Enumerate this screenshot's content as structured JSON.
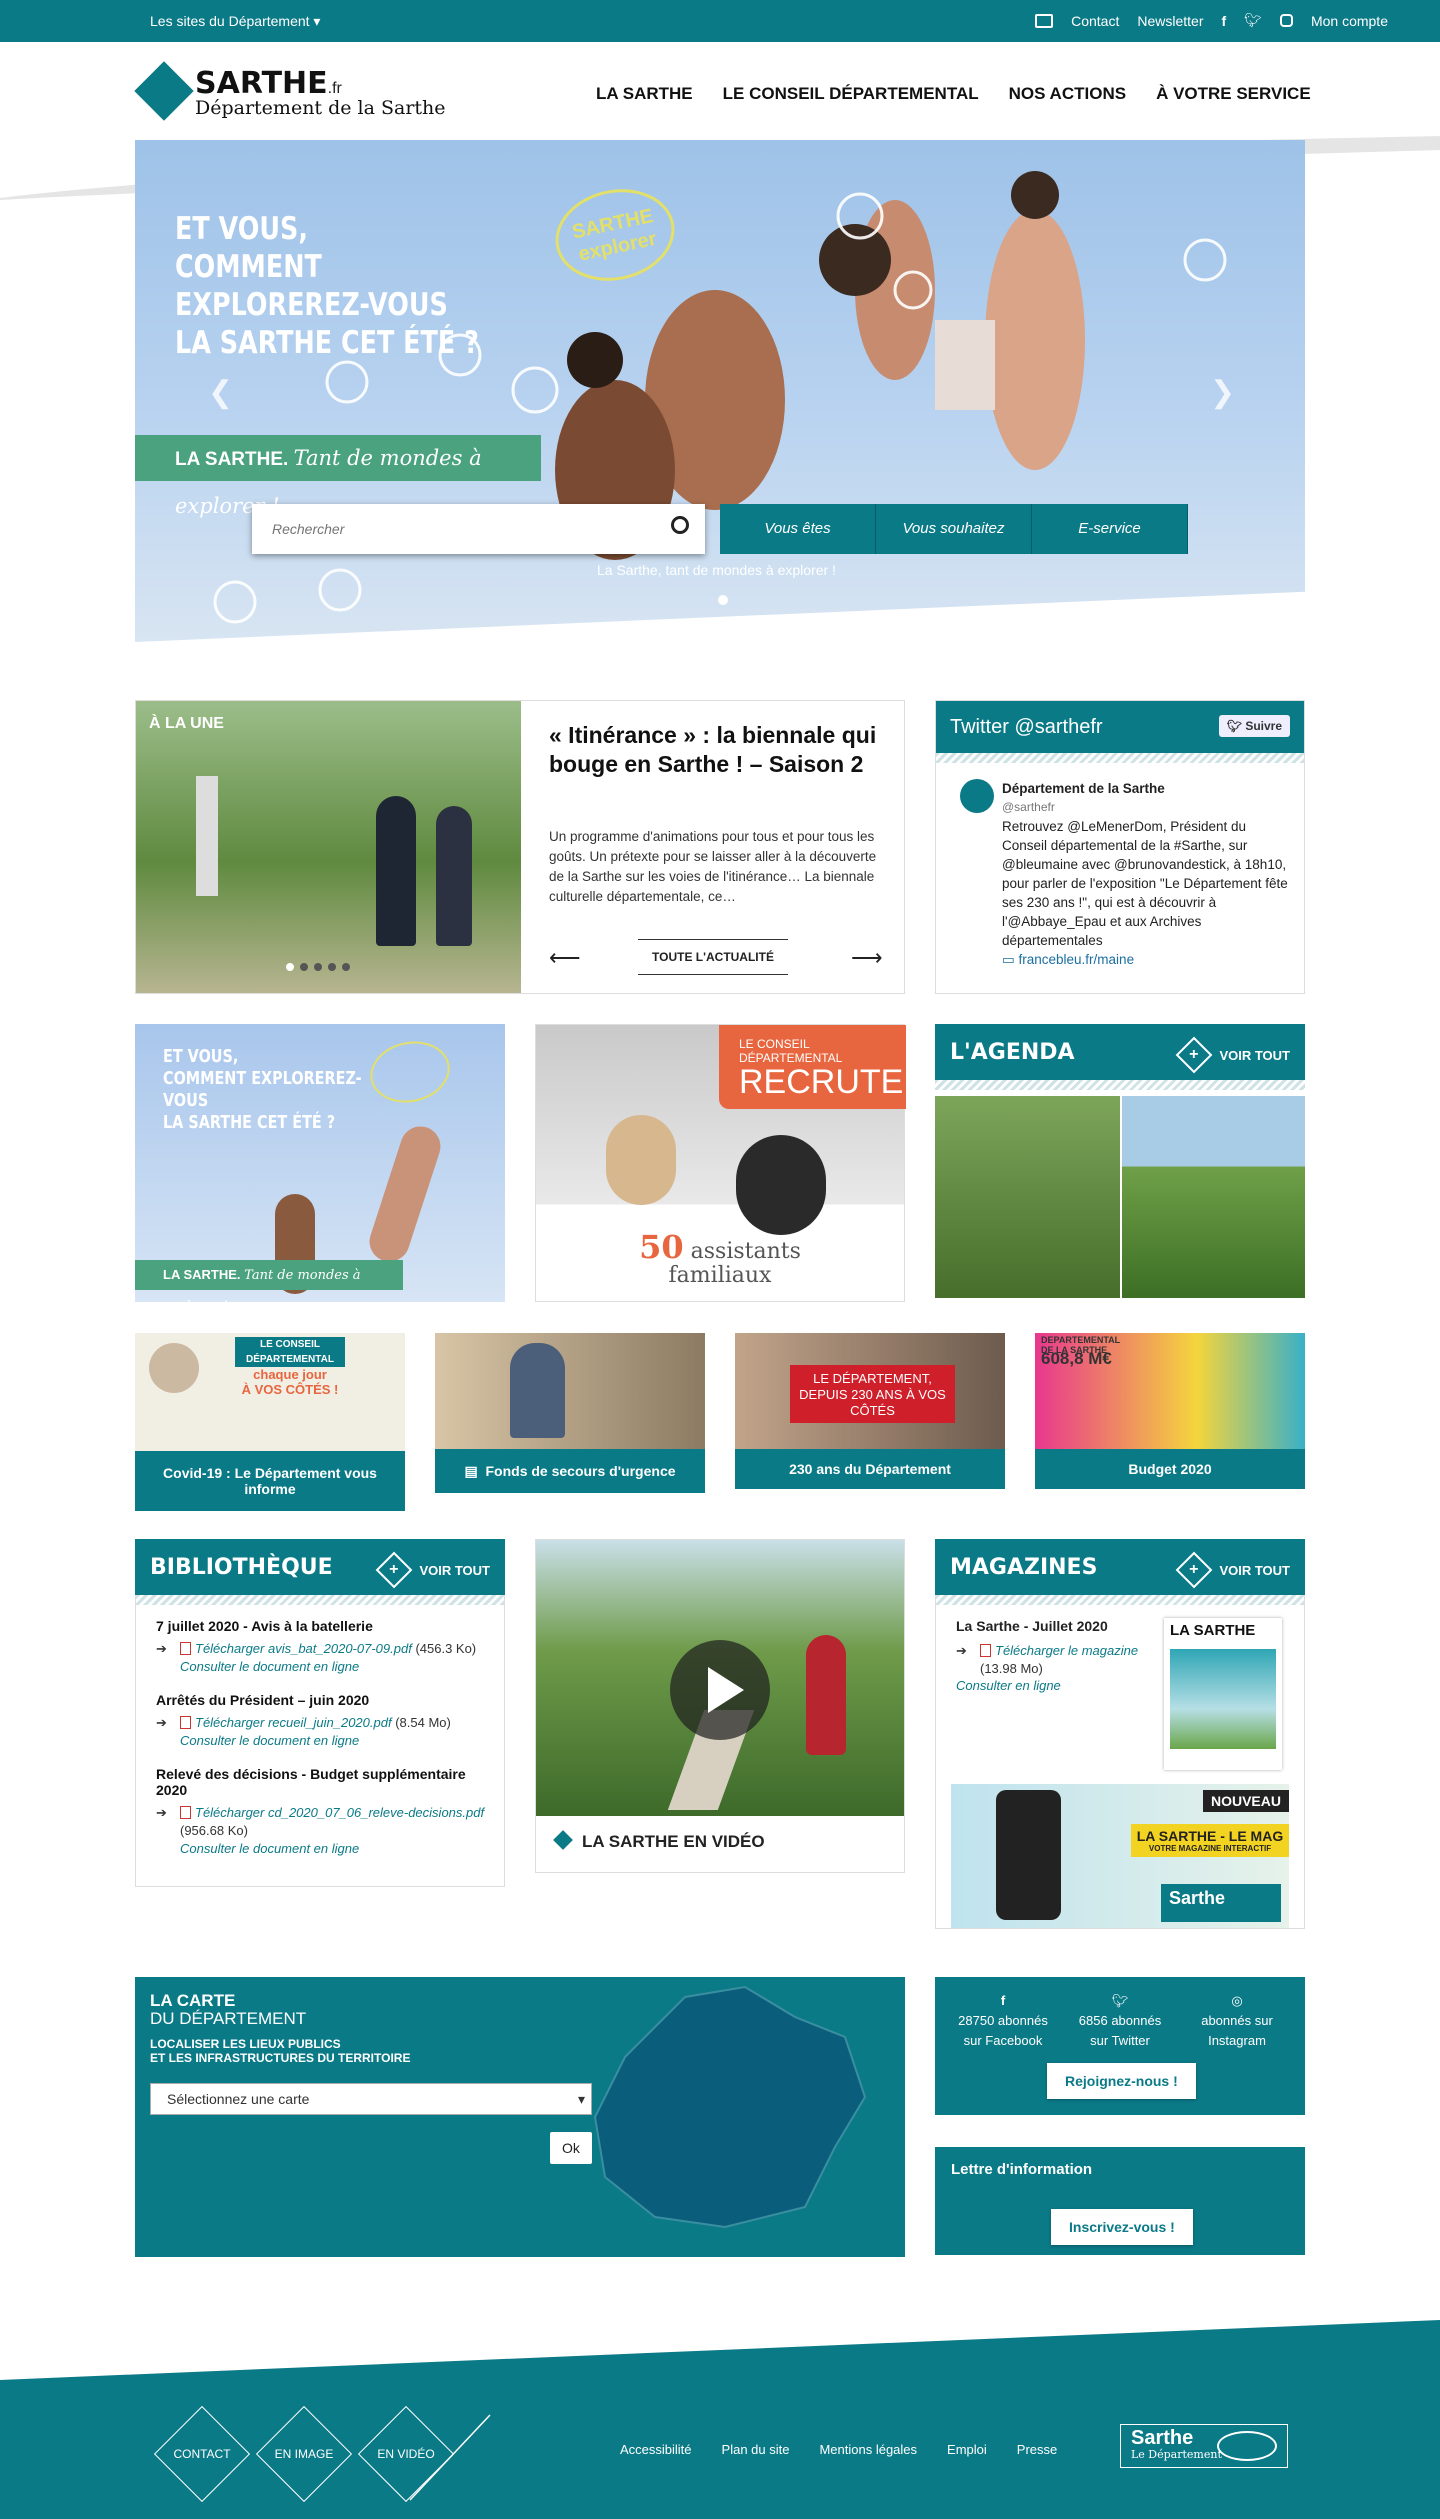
{
  "topbar": {
    "sites_label": "Les sites du Département",
    "contact": "Contact",
    "newsletter": "Newsletter",
    "account": "Mon compte"
  },
  "logo": {
    "name": "SARTHE",
    "tld": ".fr",
    "subtitle": "Département de la Sarthe"
  },
  "nav": [
    "LA SARTHE",
    "LE CONSEIL DÉPARTEMENTAL",
    "NOS ACTIONS",
    "À VOTRE SERVICE"
  ],
  "hero": {
    "title_lines": [
      "ET VOUS,",
      "COMMENT EXPLOREREZ-VOUS",
      "LA SARTHE CET ÉTÉ ?"
    ],
    "badge": "SARTHE explorer",
    "banner_bold": "LA SARTHE.",
    "banner_script": "Tant de mondes à explorer !",
    "search_placeholder": "Rechercher",
    "buttons": [
      "Vous êtes",
      "Vous souhaitez",
      "E-service"
    ],
    "caption": "La Sarthe, tant de mondes à explorer !"
  },
  "une": {
    "tag": "À LA UNE",
    "title": "« Itinérance » : la biennale qui bouge en Sarthe ! – Saison 2",
    "text": "Un programme d'animations pour tous et pour tous les goûts. Un prétexte pour se laisser aller à la découverte de la Sarthe sur les voies de l'itinérance… La biennale culturelle départementale, ce…",
    "all_news": "TOUTE L'ACTUALITÉ"
  },
  "twitter": {
    "header": "Twitter @sarthefr",
    "follow": "Suivre",
    "account": "Département de la Sarthe",
    "handle": "@sarthefr",
    "tweet": "Retrouvez @LeMenerDom, Président du Conseil départemental de la #Sarthe, sur @bleumaine avec @brunovandestick, à 18h10, pour parler de l'exposition \"Le Département fête ses 230 ans !\", qui est à découvrir à l'@Abbaye_Epau et aux Archives départementales",
    "link": "francebleu.fr/maine"
  },
  "promo": {
    "explorer_title": [
      "ET VOUS,",
      "COMMENT EXPLOREREZ-VOUS",
      "LA SARTHE CET ÉTÉ ?"
    ],
    "recrute_top": "LE CONSEIL DÉPARTEMENTAL",
    "recrute_big": "RECRUTE",
    "recrute_num": "50",
    "recrute_text1": "assistants",
    "recrute_text2": "familiaux"
  },
  "agenda": {
    "title": "L'AGENDA",
    "voir": "VOIR TOUT"
  },
  "tiles": [
    {
      "caption": "Covid-19 : Le Département vous informe",
      "img_title": "LE CONSEIL DÉPARTEMENTAL",
      "img_sub": "chaque jour",
      "img_sub2": "À VOS CÔTÉS !"
    },
    {
      "caption": "Fonds de secours d'urgence"
    },
    {
      "caption": "230 ans du Département",
      "img_text": "LE DÉPARTEMENT, DEPUIS 230 ANS À VOS CÔTÉS"
    },
    {
      "caption": "Budget 2020",
      "img_title": "DEPARTEMENTAL DE LA SARTHE",
      "img_num": "608,8 M€"
    }
  ],
  "bibliotheque": {
    "title": "BIBLIOTHÈQUE",
    "voir": "VOIR TOUT",
    "docs": [
      {
        "title": "7 juillet 2020 - Avis à la batellerie",
        "file": "Télécharger avis_bat_2020-07-09.pdf",
        "size": "(456.3 Ko)",
        "online": "Consulter le document en ligne"
      },
      {
        "title": "Arrêtés du Président – juin 2020",
        "file": "Télécharger recueil_juin_2020.pdf",
        "size": "(8.54 Mo)",
        "online": "Consulter le document en ligne"
      },
      {
        "title": "Relevé des décisions - Budget supplémentaire 2020",
        "file": "Télécharger cd_2020_07_06_releve-decisions.pdf",
        "size": "(956.68 Ko)",
        "online": "Consulter le document en ligne"
      }
    ]
  },
  "video": {
    "label": "LA SARTHE EN VIDÉO"
  },
  "magazines": {
    "title": "MAGAZINES",
    "voir": "VOIR TOUT",
    "issue": "La Sarthe - Juillet 2020",
    "download": "Télécharger le magazine",
    "size": "(13.98 Mo)",
    "online": "Consulter en ligne",
    "cover_title": "LA SARTHE",
    "promo_new": "NOUVEAU",
    "promo_title": "LA SARTHE - LE MAG",
    "promo_sub": "VOTRE MAGAZINE INTERACTIF",
    "promo_logo": "Sarthe"
  },
  "carte": {
    "title1": "LA CARTE",
    "title2": "DU DÉPARTEMENT",
    "subtitle1": "LOCALISER LES LIEUX PUBLICS",
    "subtitle2": "ET LES INFRASTRUCTURES DU TERRITOIRE",
    "select": "Sélectionnez une carte",
    "ok": "Ok"
  },
  "social": {
    "facebook": "28750 abonnés sur Facebook",
    "twitter": "6856 abonnés sur Twitter",
    "instagram": "abonnés sur Instagram",
    "join": "Rejoignez-nous !"
  },
  "newsletter": {
    "title": "Lettre d'information",
    "btn": "Inscrivez-vous !"
  },
  "footer": {
    "diamonds": [
      "CONTACT",
      "EN IMAGE",
      "EN VIDÉO"
    ],
    "links": [
      "Accessibilité",
      "Plan du site",
      "Mentions légales",
      "Emploi",
      "Presse"
    ],
    "logo": "Sarthe",
    "logo_sub": "Le Département"
  },
  "colors": {
    "primary": "#0b7a87",
    "green": "#4aa27f",
    "orange": "#e8663f"
  }
}
